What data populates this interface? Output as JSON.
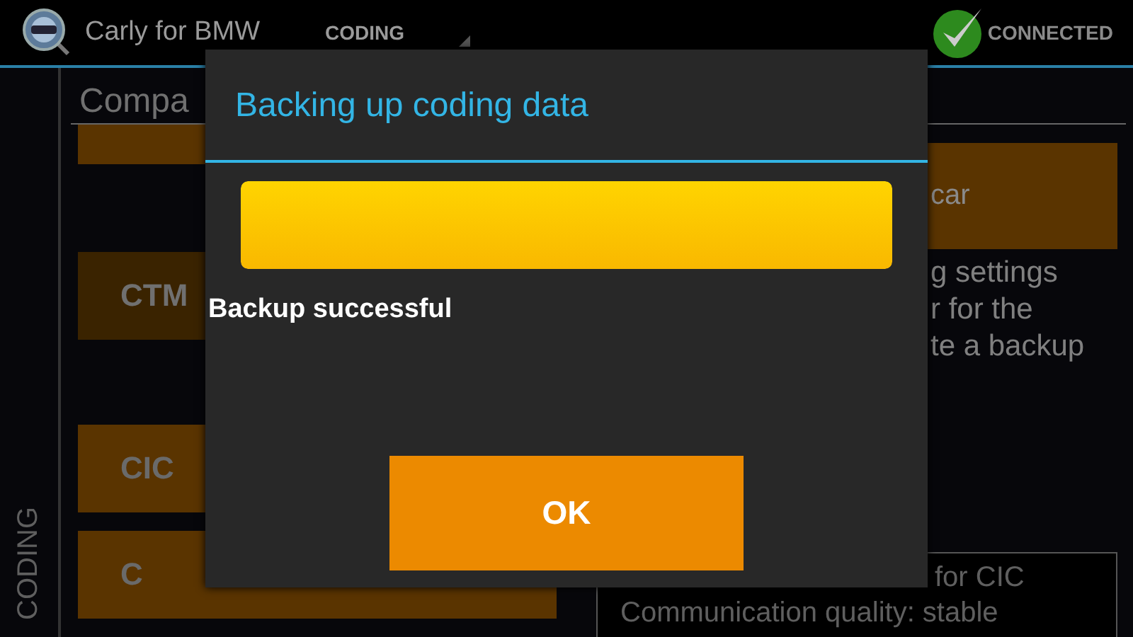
{
  "app": {
    "title": "Carly for BMW",
    "section": "CODING",
    "connection": {
      "label": "CONNECTED",
      "connected": true
    }
  },
  "sidebar": {
    "label": "CODING"
  },
  "page": {
    "heading": "Compa",
    "left_buttons": [
      {
        "disabled": false
      },
      {
        "label": "CTM",
        "disabled": true
      },
      {
        "label": "CIC",
        "disabled": false
      },
      {
        "label": "C",
        "disabled": false
      }
    ],
    "right": {
      "button": "car",
      "description": [
        "g settings",
        "r for the",
        "te a backup"
      ],
      "status": [
        "for CIC",
        "Communication quality: stable"
      ]
    }
  },
  "dialog": {
    "title": "Backing up coding data",
    "progress": {
      "level": 1
    },
    "message": "Backup successful",
    "buttons": [
      "OK"
    ]
  }
}
